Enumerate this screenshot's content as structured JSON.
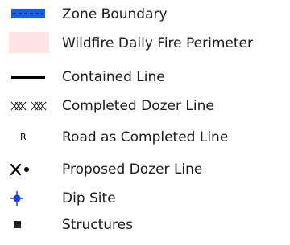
{
  "legend": {
    "items": [
      {
        "label": "Zone Boundary",
        "icon": "zone-boundary-symbol",
        "color": "#1a5fe0"
      },
      {
        "label": "Wildfire Daily Fire Perimeter",
        "icon": "fire-perimeter-symbol",
        "color": "#fde3e3"
      },
      {
        "label": "Contained Line",
        "icon": "contained-line-symbol",
        "color": "#000000"
      },
      {
        "label": "Completed Dozer Line",
        "icon": "completed-dozer-line-symbol",
        "color": "#000000"
      },
      {
        "label": "Road as Completed Line",
        "icon": "road-completed-line-symbol",
        "glyph": "R",
        "color": "#000000"
      },
      {
        "label": "Proposed Dozer Line",
        "icon": "proposed-dozer-line-symbol",
        "color": "#000000"
      },
      {
        "label": "Dip Site",
        "icon": "dip-site-symbol",
        "color": "#1a3fd6"
      },
      {
        "label": "Structures",
        "icon": "structures-symbol",
        "color": "#222222"
      }
    ]
  }
}
